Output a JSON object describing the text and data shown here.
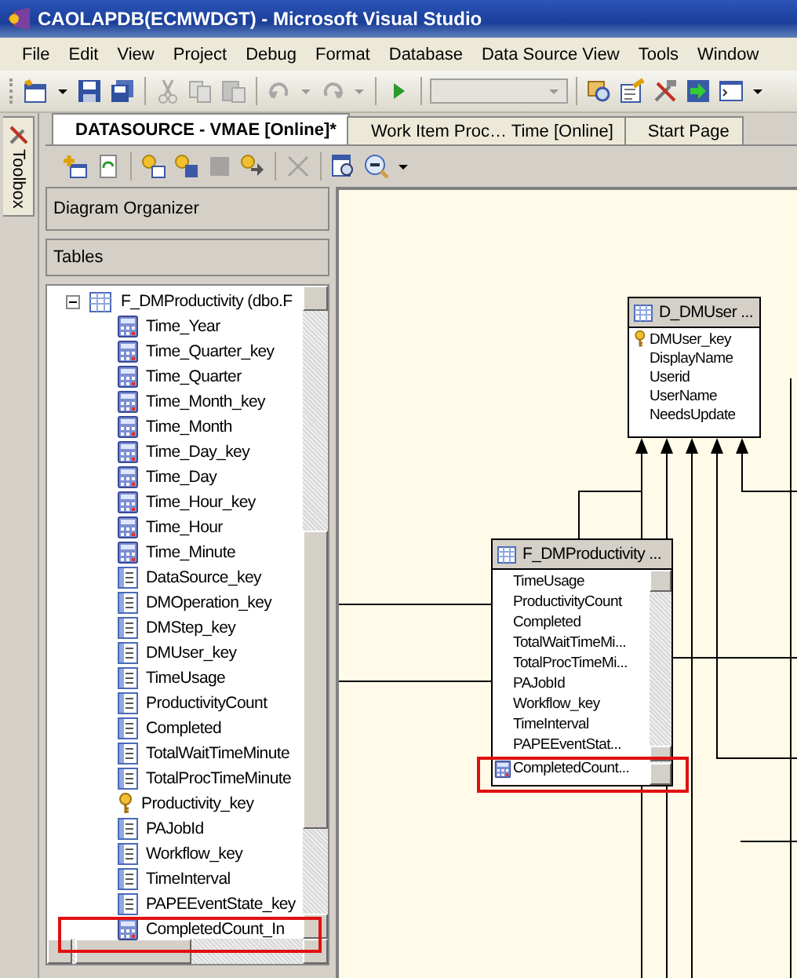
{
  "window": {
    "title": "CAOLAPDB(ECMWDGT) - Microsoft Visual Studio"
  },
  "menu": [
    "File",
    "Edit",
    "View",
    "Project",
    "Debug",
    "Format",
    "Database",
    "Data Source View",
    "Tools",
    "Window"
  ],
  "side_tab": {
    "label": "Toolbox"
  },
  "tabs": [
    {
      "label": "DATASOURCE - VMAE [Online]*",
      "selected": true
    },
    {
      "label": "Work Item Proc… Time [Online]",
      "selected": false
    },
    {
      "label": "Start Page",
      "selected": false
    }
  ],
  "panes": {
    "organizer": "Diagram Organizer",
    "tables": "Tables"
  },
  "tree": {
    "label": "F_DMProductivity (dbo.F",
    "expanded": true,
    "children": [
      {
        "label": "Time_Year",
        "kind": "calculated",
        "highlighted": false
      },
      {
        "label": "Time_Quarter_key",
        "kind": "calculated",
        "highlighted": false
      },
      {
        "label": "Time_Quarter",
        "kind": "calculated",
        "highlighted": false
      },
      {
        "label": "Time_Month_key",
        "kind": "calculated",
        "highlighted": false
      },
      {
        "label": "Time_Month",
        "kind": "calculated",
        "highlighted": false
      },
      {
        "label": "Time_Day_key",
        "kind": "calculated",
        "highlighted": false
      },
      {
        "label": "Time_Day",
        "kind": "calculated",
        "highlighted": false
      },
      {
        "label": "Time_Hour_key",
        "kind": "calculated",
        "highlighted": false
      },
      {
        "label": "Time_Hour",
        "kind": "calculated",
        "highlighted": false
      },
      {
        "label": "Time_Minute",
        "kind": "calculated",
        "highlighted": false
      },
      {
        "label": "DataSource_key",
        "kind": "column",
        "highlighted": false
      },
      {
        "label": "DMOperation_key",
        "kind": "column",
        "highlighted": false
      },
      {
        "label": "DMStep_key",
        "kind": "column",
        "highlighted": false
      },
      {
        "label": "DMUser_key",
        "kind": "column",
        "highlighted": false
      },
      {
        "label": "TimeUsage",
        "kind": "column",
        "highlighted": false
      },
      {
        "label": "ProductivityCount",
        "kind": "column",
        "highlighted": false
      },
      {
        "label": "Completed",
        "kind": "column",
        "highlighted": false
      },
      {
        "label": "TotalWaitTimeMinute",
        "kind": "column",
        "highlighted": false
      },
      {
        "label": "TotalProcTimeMinute",
        "kind": "column",
        "highlighted": false
      },
      {
        "label": "Productivity_key",
        "kind": "key",
        "highlighted": false
      },
      {
        "label": "PAJobId",
        "kind": "column",
        "highlighted": false
      },
      {
        "label": "Workflow_key",
        "kind": "column",
        "highlighted": false
      },
      {
        "label": "TimeInterval",
        "kind": "column",
        "highlighted": false
      },
      {
        "label": "PAPEEventState_key",
        "kind": "column",
        "highlighted": false
      },
      {
        "label": "CompletedCount_In",
        "kind": "calculated",
        "highlighted": true
      }
    ]
  },
  "canvas": {
    "tables": [
      {
        "title": "D_DMUser ...",
        "fields": [
          {
            "name": "DMUser_key",
            "kind": "key",
            "highlighted": false
          },
          {
            "name": "DisplayName",
            "kind": "column",
            "highlighted": false
          },
          {
            "name": "Userid",
            "kind": "column",
            "highlighted": false
          },
          {
            "name": "UserName",
            "kind": "column",
            "highlighted": false
          },
          {
            "name": "NeedsUpdate",
            "kind": "column",
            "highlighted": false
          }
        ]
      },
      {
        "title": "F_DMProductivity ...",
        "fields": [
          {
            "name": "TimeUsage",
            "kind": "column",
            "highlighted": false
          },
          {
            "name": "ProductivityCount",
            "kind": "column",
            "highlighted": false
          },
          {
            "name": "Completed",
            "kind": "column",
            "highlighted": false
          },
          {
            "name": "TotalWaitTimeMi...",
            "kind": "column",
            "highlighted": false
          },
          {
            "name": "TotalProcTimeMi...",
            "kind": "column",
            "highlighted": false
          },
          {
            "name": "PAJobId",
            "kind": "column",
            "highlighted": false
          },
          {
            "name": "Workflow_key",
            "kind": "column",
            "highlighted": false
          },
          {
            "name": "TimeInterval",
            "kind": "column",
            "highlighted": false
          },
          {
            "name": "PAPEEventStat...",
            "kind": "column",
            "highlighted": false
          },
          {
            "name": "CompletedCount...",
            "kind": "calculated",
            "highlighted": true
          }
        ]
      }
    ]
  }
}
